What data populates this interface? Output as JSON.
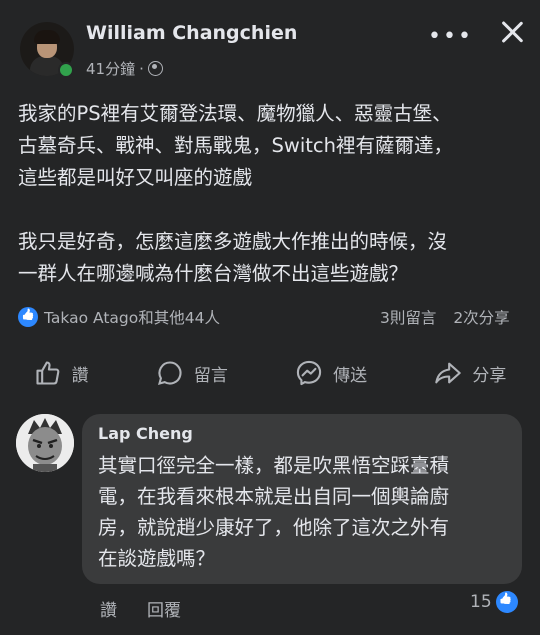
{
  "post": {
    "author": "William Changchien",
    "time": "41分鐘",
    "separator": "·",
    "privacy_icon": "globe-icon",
    "body": [
      "我家的PS裡有艾爾登法環、魔物獵人、惡靈古堡、",
      "古墓奇兵、戰神、對馬戰鬼，Switch裡有薩爾達，",
      "這些都是叫好又叫座的遊戲",
      "我只是好奇，怎麼這麼多遊戲大作推出的時候，沒",
      "一群人在哪邊喊為什麼台灣做不出這些遊戲？"
    ],
    "reactions_text": "Takao Atago和其他44人",
    "comments_count": "3則留言",
    "shares_count": "2次分享"
  },
  "actions": {
    "like": "讚",
    "comment": "留言",
    "send": "傳送",
    "share": "分享"
  },
  "comment": {
    "author": "Lap Cheng",
    "body": [
      "其實口徑完全一樣，都是吹黑悟空踩臺積",
      "電，在我看來根本就是出自同一個輿論廚",
      "房，就說趙少康好了，他除了這次之外有",
      "在談遊戲嗎？"
    ],
    "like_label": "讚",
    "reply_label": "回覆",
    "like_count": "15"
  },
  "colors": {
    "background": "#242526",
    "bubble": "#3a3b3c",
    "text": "#e4e6eb",
    "secondary": "#b0b3b8",
    "accent": "#2d88ff",
    "online": "#31a24c"
  }
}
